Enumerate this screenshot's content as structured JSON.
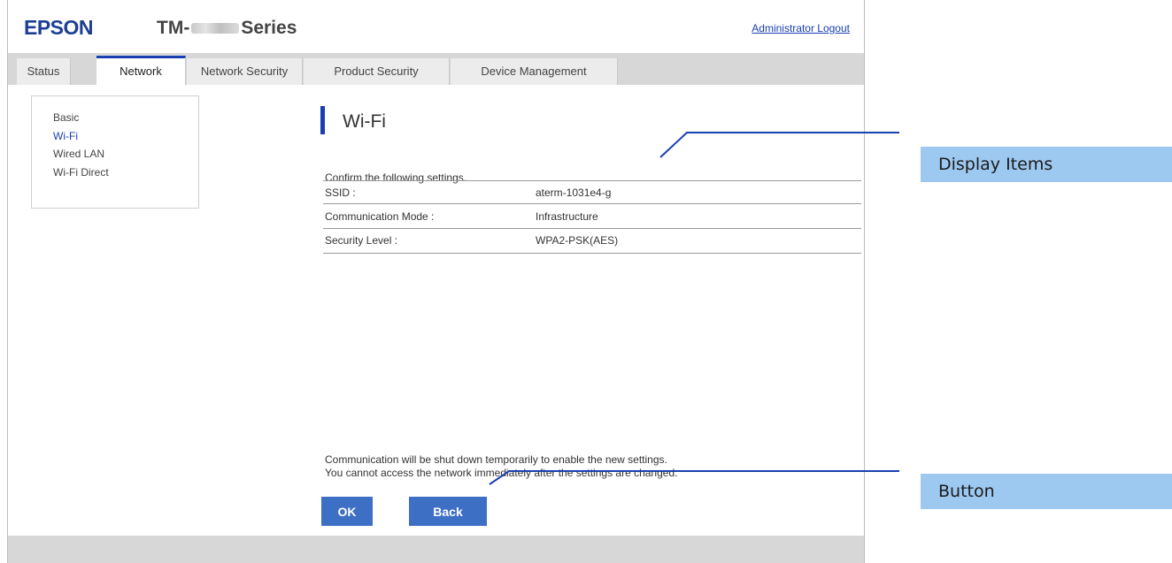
{
  "header": {
    "brand": "EPSON",
    "model_prefix": "TM-",
    "model_suffix": "Series",
    "admin_logout": "Administrator Logout"
  },
  "tabs": [
    {
      "label": "Status",
      "active": false
    },
    {
      "label": "Network",
      "active": true
    },
    {
      "label": "Network Security",
      "active": false
    },
    {
      "label": "Product Security",
      "active": false
    },
    {
      "label": "Device Management",
      "active": false
    }
  ],
  "sidebar": {
    "items": [
      {
        "label": "Basic",
        "active": false
      },
      {
        "label": "Wi-Fi",
        "active": true
      },
      {
        "label": "Wired LAN",
        "active": false
      },
      {
        "label": "Wi-Fi Direct",
        "active": false
      }
    ]
  },
  "main": {
    "title": "Wi-Fi",
    "confirm_text": "Confirm the following settings.",
    "rows": [
      {
        "label": "SSID :",
        "value": "aterm-1031e4-g"
      },
      {
        "label": "Communication Mode :",
        "value": "Infrastructure"
      },
      {
        "label": "Security Level :",
        "value": "WPA2-PSK(AES)"
      }
    ],
    "notice": [
      "Communication will be shut down temporarily to enable the new settings.",
      "You cannot access the network immediately after the settings are changed."
    ],
    "buttons": {
      "ok": "OK",
      "back": "Back"
    }
  },
  "annotations": {
    "display_items": "Display Items",
    "button": "Button"
  },
  "colors": {
    "accent": "#1a3fb3",
    "button": "#3d6fc4",
    "callout": "#9dc8f0"
  }
}
